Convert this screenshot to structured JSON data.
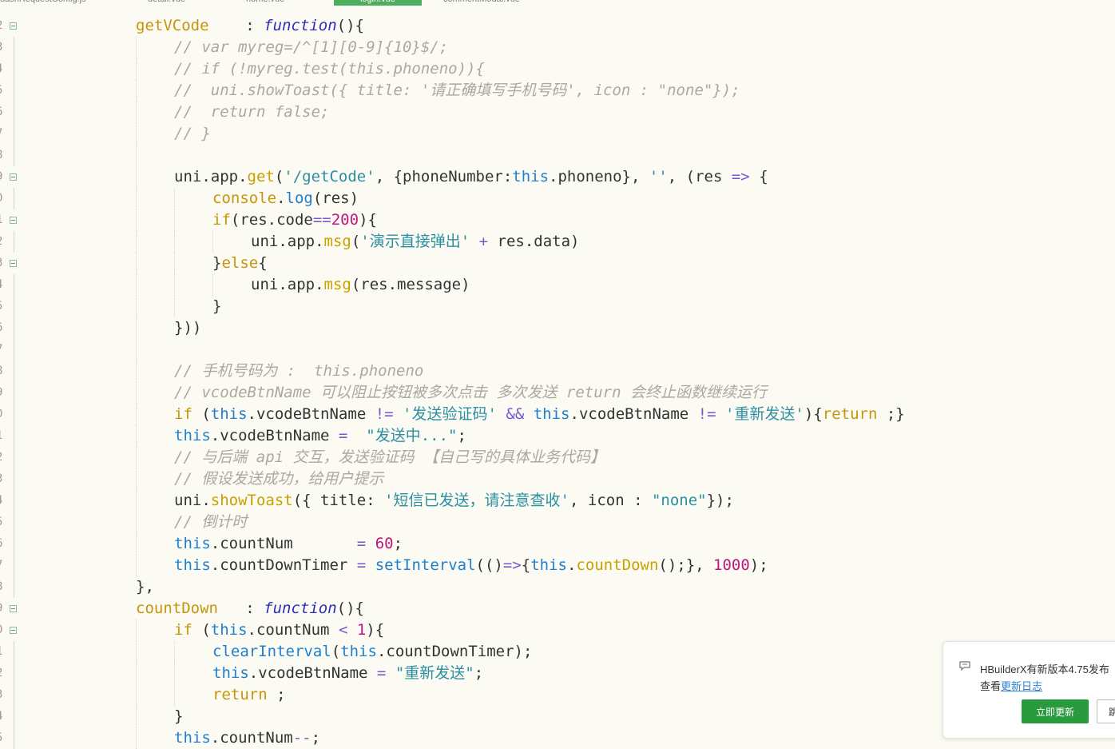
{
  "tabs": [
    {
      "label": "uashRequestConfig.js",
      "active": false
    },
    {
      "label": "detail.vue",
      "active": false
    },
    {
      "label": "home.vue",
      "active": false
    },
    {
      "label": "login.vue",
      "active": true
    },
    {
      "label": "commentModal.vue",
      "active": false
    }
  ],
  "gutter": {
    "line_numbers": [
      "2",
      "3",
      "4",
      "5",
      "6",
      "7",
      "8",
      "9",
      "0",
      "1",
      "2",
      "3",
      "4",
      "5",
      "6",
      "7",
      "8",
      "9",
      "0",
      "1",
      "2",
      "3",
      "4",
      "5",
      "6",
      "7",
      "8",
      "9",
      "0",
      "1",
      "2",
      "3",
      "4",
      "5"
    ],
    "fold_rows": [
      0,
      7,
      9,
      11,
      27,
      28
    ]
  },
  "code_lines": [
    {
      "indent": 3,
      "tokens": [
        [
          "k",
          "getVCode"
        ],
        [
          "p",
          "    : "
        ],
        [
          "f",
          "function"
        ],
        [
          "p",
          "(){"
        ]
      ]
    },
    {
      "indent": 4,
      "tokens": [
        [
          "c",
          "// var myreg=/^[1][0-9]{10}$/;"
        ]
      ]
    },
    {
      "indent": 4,
      "tokens": [
        [
          "c",
          "// if (!myreg.test(this.phoneno)){"
        ]
      ]
    },
    {
      "indent": 4,
      "tokens": [
        [
          "c",
          "//  uni.showToast({ title: '请正确填写手机号码', icon : \"none\"});"
        ]
      ]
    },
    {
      "indent": 4,
      "tokens": [
        [
          "c",
          "//  return false;"
        ]
      ]
    },
    {
      "indent": 4,
      "tokens": [
        [
          "c",
          "// }"
        ]
      ]
    },
    {
      "indent": 4,
      "tokens": []
    },
    {
      "indent": 4,
      "tokens": [
        [
          "p",
          "uni.app."
        ],
        [
          "m",
          "get"
        ],
        [
          "p",
          "("
        ],
        [
          "s",
          "'/getCode'"
        ],
        [
          "p",
          ", {phoneNumber:"
        ],
        [
          "kw",
          "this"
        ],
        [
          "p",
          ".phoneno}, "
        ],
        [
          "s",
          "''"
        ],
        [
          "p",
          ", (res "
        ],
        [
          "o",
          "=>"
        ],
        [
          "p",
          " {"
        ]
      ]
    },
    {
      "indent": 5,
      "tokens": [
        [
          "k",
          "console"
        ],
        [
          "p",
          "."
        ],
        [
          "kw",
          "log"
        ],
        [
          "p",
          "(res)"
        ]
      ]
    },
    {
      "indent": 5,
      "tokens": [
        [
          "k",
          "if"
        ],
        [
          "p",
          "(res.code"
        ],
        [
          "o",
          "=="
        ],
        [
          "n",
          "200"
        ],
        [
          "p",
          "){"
        ]
      ]
    },
    {
      "indent": 6,
      "tokens": [
        [
          "p",
          "uni.app."
        ],
        [
          "m",
          "msg"
        ],
        [
          "p",
          "("
        ],
        [
          "s",
          "'演示直接弹出'"
        ],
        [
          "p",
          " "
        ],
        [
          "o",
          "+"
        ],
        [
          "p",
          " res.data)"
        ]
      ]
    },
    {
      "indent": 5,
      "tokens": [
        [
          "p",
          "}"
        ],
        [
          "k",
          "else"
        ],
        [
          "p",
          "{"
        ]
      ]
    },
    {
      "indent": 6,
      "tokens": [
        [
          "p",
          "uni.app."
        ],
        [
          "m",
          "msg"
        ],
        [
          "p",
          "(res.message)"
        ]
      ]
    },
    {
      "indent": 5,
      "tokens": [
        [
          "p",
          "}"
        ]
      ]
    },
    {
      "indent": 4,
      "tokens": [
        [
          "p",
          "}))"
        ]
      ]
    },
    {
      "indent": 4,
      "tokens": []
    },
    {
      "indent": 4,
      "tokens": [
        [
          "c",
          "// 手机号码为 :  this.phoneno"
        ]
      ]
    },
    {
      "indent": 4,
      "tokens": [
        [
          "c",
          "// vcodeBtnName 可以阻止按钮被多次点击 多次发送 return 会终止函数继续运行"
        ]
      ]
    },
    {
      "indent": 4,
      "tokens": [
        [
          "k",
          "if"
        ],
        [
          "p",
          " ("
        ],
        [
          "kw",
          "this"
        ],
        [
          "p",
          ".vcodeBtnName "
        ],
        [
          "o",
          "!="
        ],
        [
          "p",
          " "
        ],
        [
          "s",
          "'发送验证码'"
        ],
        [
          "p",
          " "
        ],
        [
          "o",
          "&&"
        ],
        [
          "p",
          " "
        ],
        [
          "kw",
          "this"
        ],
        [
          "p",
          ".vcodeBtnName "
        ],
        [
          "o",
          "!="
        ],
        [
          "p",
          " "
        ],
        [
          "s",
          "'重新发送'"
        ],
        [
          "p",
          "){"
        ],
        [
          "k",
          "return"
        ],
        [
          "p",
          " ;}"
        ]
      ]
    },
    {
      "indent": 4,
      "tokens": [
        [
          "kw",
          "this"
        ],
        [
          "p",
          ".vcodeBtnName "
        ],
        [
          "o",
          "="
        ],
        [
          "p",
          "  "
        ],
        [
          "s",
          "\"发送中...\""
        ],
        [
          "p",
          ";"
        ]
      ]
    },
    {
      "indent": 4,
      "tokens": [
        [
          "c",
          "// 与后端 api 交互，发送验证码 【自己写的具体业务代码】"
        ]
      ]
    },
    {
      "indent": 4,
      "tokens": [
        [
          "c",
          "// 假设发送成功，给用户提示"
        ]
      ]
    },
    {
      "indent": 4,
      "tokens": [
        [
          "p",
          "uni."
        ],
        [
          "m",
          "showToast"
        ],
        [
          "p",
          "({ title: "
        ],
        [
          "s",
          "'短信已发送，请注意查收'"
        ],
        [
          "p",
          ", icon : "
        ],
        [
          "s",
          "\"none\""
        ],
        [
          "p",
          "});"
        ]
      ]
    },
    {
      "indent": 4,
      "tokens": [
        [
          "c",
          "// 倒计时"
        ]
      ]
    },
    {
      "indent": 4,
      "tokens": [
        [
          "kw",
          "this"
        ],
        [
          "p",
          ".countNum       "
        ],
        [
          "o",
          "="
        ],
        [
          "p",
          " "
        ],
        [
          "n",
          "60"
        ],
        [
          "p",
          ";"
        ]
      ]
    },
    {
      "indent": 4,
      "tokens": [
        [
          "kw",
          "this"
        ],
        [
          "p",
          ".countDownTimer "
        ],
        [
          "o",
          "="
        ],
        [
          "p",
          " "
        ],
        [
          "kw",
          "setInterval"
        ],
        [
          "p",
          "(()"
        ],
        [
          "o",
          "=>"
        ],
        [
          "p",
          "{"
        ],
        [
          "kw",
          "this"
        ],
        [
          "p",
          "."
        ],
        [
          "m",
          "countDown"
        ],
        [
          "p",
          "();}, "
        ],
        [
          "n",
          "1000"
        ],
        [
          "p",
          ");"
        ]
      ]
    },
    {
      "indent": 3,
      "tokens": [
        [
          "p",
          "},"
        ]
      ]
    },
    {
      "indent": 3,
      "tokens": [
        [
          "k",
          "countDown"
        ],
        [
          "p",
          "   : "
        ],
        [
          "f",
          "function"
        ],
        [
          "p",
          "(){"
        ]
      ]
    },
    {
      "indent": 4,
      "tokens": [
        [
          "k",
          "if"
        ],
        [
          "p",
          " ("
        ],
        [
          "kw",
          "this"
        ],
        [
          "p",
          ".countNum "
        ],
        [
          "o",
          "<"
        ],
        [
          "p",
          " "
        ],
        [
          "n",
          "1"
        ],
        [
          "p",
          "){"
        ]
      ]
    },
    {
      "indent": 5,
      "tokens": [
        [
          "kw",
          "clearInterval"
        ],
        [
          "p",
          "("
        ],
        [
          "kw",
          "this"
        ],
        [
          "p",
          ".countDownTimer);"
        ]
      ]
    },
    {
      "indent": 5,
      "tokens": [
        [
          "kw",
          "this"
        ],
        [
          "p",
          ".vcodeBtnName "
        ],
        [
          "o",
          "="
        ],
        [
          "p",
          " "
        ],
        [
          "s",
          "\"重新发送\""
        ],
        [
          "p",
          ";"
        ]
      ]
    },
    {
      "indent": 5,
      "tokens": [
        [
          "k",
          "return"
        ],
        [
          "p",
          " ;"
        ]
      ]
    },
    {
      "indent": 4,
      "tokens": [
        [
          "p",
          "}"
        ]
      ]
    },
    {
      "indent": 4,
      "tokens": [
        [
          "kw",
          "this"
        ],
        [
          "p",
          ".countNum"
        ],
        [
          "o",
          "--"
        ],
        [
          "p",
          ";"
        ]
      ]
    }
  ],
  "notification": {
    "icon": "message-icon",
    "title": "HBuilderX有新版本4.75发布",
    "prefix": "查看",
    "link": "更新日志",
    "update_button": "立即更新",
    "skip_button": "跳过"
  }
}
